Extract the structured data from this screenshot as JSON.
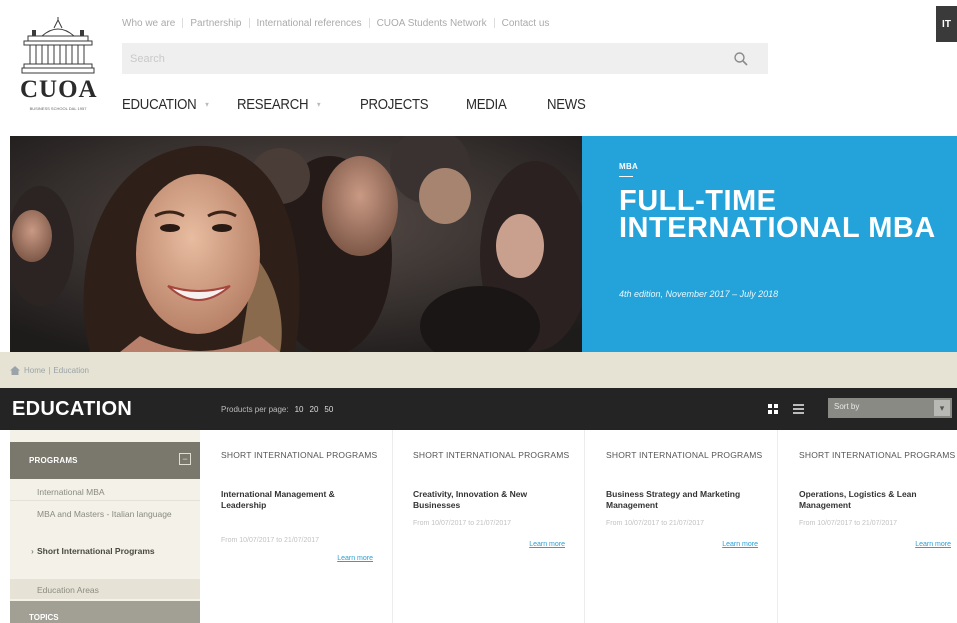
{
  "header": {
    "logo_text": "CUOA",
    "logo_subtitle": "BUSINESS SCHOOL DAL 1957",
    "top_links": [
      "Who we are",
      "Partnership",
      "International references",
      "CUOA Students Network",
      "Contact us"
    ],
    "language_button": "IT",
    "search": {
      "placeholder": "Search",
      "icon": "search-icon"
    },
    "nav": [
      {
        "label": "EDUCATION",
        "has_dropdown": true
      },
      {
        "label": "RESEARCH",
        "has_dropdown": true
      },
      {
        "label": "PROJECTS",
        "has_dropdown": false
      },
      {
        "label": "MEDIA",
        "has_dropdown": false
      },
      {
        "label": "NEWS",
        "has_dropdown": false
      }
    ]
  },
  "hero": {
    "tag": "MBA",
    "title": "FULL-TIME INTERNATIONAL MBA",
    "subtitle": "4th edition, November 2017 – July 2018",
    "panel_color": "#23a3d9"
  },
  "breadcrumb": {
    "home": "Home",
    "separator": "|",
    "current": "Education"
  },
  "section": {
    "title": "EDUCATION",
    "products_per_page_label": "Products per page:",
    "per_page_options": [
      "10",
      "20",
      "50"
    ],
    "view_icons": [
      "grid-view-icon",
      "list-view-icon"
    ],
    "sort_label": "Sort by"
  },
  "sidebar": {
    "programs_label": "PROGRAMS",
    "toggle_symbol": "⊟",
    "items": [
      {
        "label": "International MBA",
        "active": false
      },
      {
        "label": "MBA and Masters - Italian language",
        "active": false
      },
      {
        "label": "Short International Programs",
        "active": true
      },
      {
        "label": "Education Areas",
        "active": false
      }
    ],
    "topics_label": "TOPICS"
  },
  "cards": [
    {
      "category": "SHORT INTERNATIONAL PROGRAMS",
      "title": "International Management & Leadership",
      "dates": "From 10/07/2017 to 21/07/2017",
      "link": "Learn more"
    },
    {
      "category": "SHORT INTERNATIONAL PROGRAMS",
      "title": "Creativity, Innovation & New Businesses",
      "dates": "From 10/07/2017 to 21/07/2017",
      "link": "Learn more"
    },
    {
      "category": "SHORT INTERNATIONAL PROGRAMS",
      "title": "Business Strategy and Marketing Management",
      "dates": "From 10/07/2017 to 21/07/2017",
      "link": "Learn more"
    },
    {
      "category": "SHORT INTERNATIONAL PROGRAMS",
      "title": "Operations, Logistics & Lean Management",
      "dates": "From 10/07/2017 to 21/07/2017",
      "link": "Learn more"
    }
  ]
}
